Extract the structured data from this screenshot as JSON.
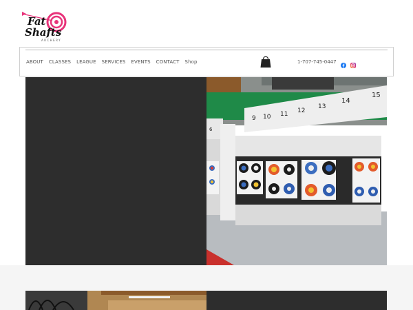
{
  "brand": {
    "logo_line1": "Fat",
    "logo_line2": "Shafts",
    "logo_sub": "ARCHERY"
  },
  "nav": {
    "items": [
      {
        "label": "ABOUT"
      },
      {
        "label": "CLASSES"
      },
      {
        "label": "LEAGUE"
      },
      {
        "label": "SERVICES"
      },
      {
        "label": "EVENTS"
      },
      {
        "label": "CONTACT"
      },
      {
        "label": "Shop"
      }
    ],
    "phone": "1-707-745-0447"
  },
  "hero": {
    "lane_numbers": [
      "9",
      "10",
      "11",
      "12",
      "13",
      "14",
      "15"
    ],
    "left_lane_number": "6"
  },
  "colors": {
    "accent_pink": "#e8337a",
    "dark_panel": "#2d2d2d",
    "facebook": "#1877f2"
  },
  "icons": [
    "shopping-bag-icon",
    "facebook-icon",
    "instagram-icon"
  ]
}
